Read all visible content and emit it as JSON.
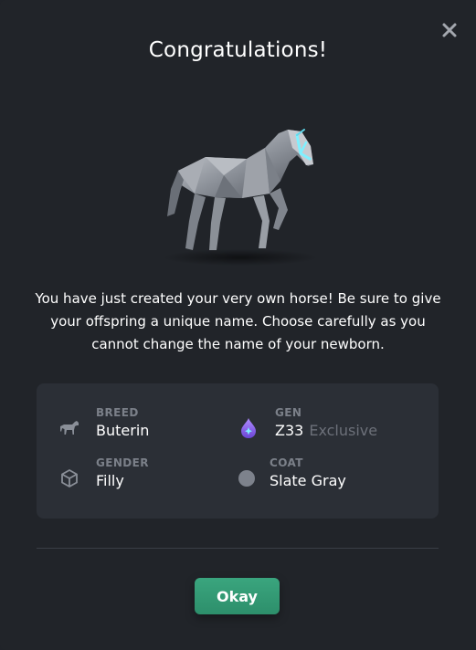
{
  "dialog": {
    "title": "Congratulations!",
    "message": "You have just created your very own horse! Be sure to give your offspring a unique name. Choose carefully as you cannot change the name of your newborn.",
    "close_icon": "close-icon"
  },
  "horse": {
    "breed_label": "BREED",
    "breed": "Buterin",
    "gen_label": "GEN",
    "gen": "Z33",
    "gen_tier": "Exclusive",
    "gender_label": "GENDER",
    "gender": "Filly",
    "coat_label": "COAT",
    "coat": "Slate Gray",
    "coat_color": "#7d828c"
  },
  "actions": {
    "okay_label": "Okay"
  },
  "colors": {
    "background": "#212429",
    "card": "#2b2f36",
    "accent": "#33a077",
    "muted_text": "#7b8089"
  }
}
